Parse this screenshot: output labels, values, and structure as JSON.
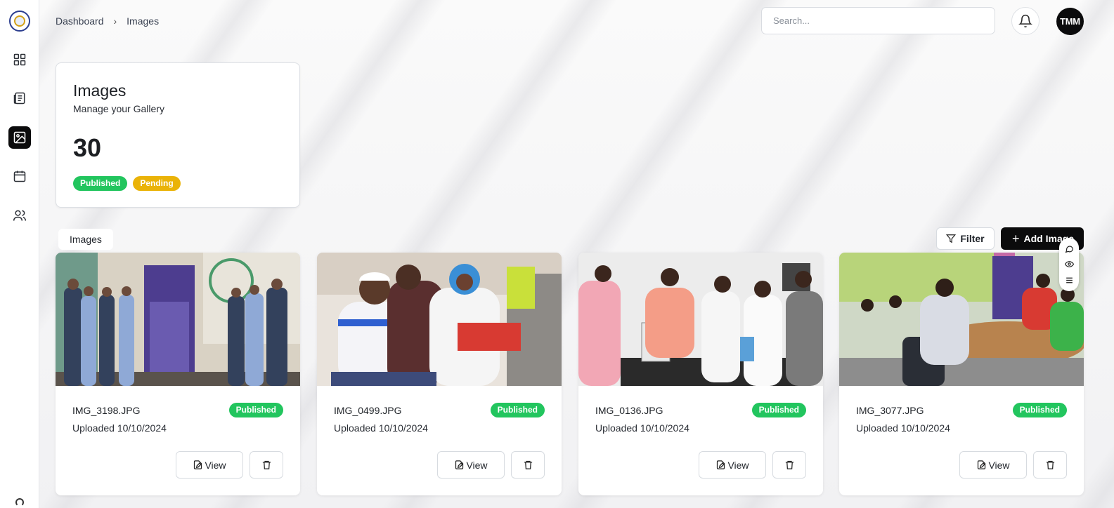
{
  "breadcrumb": {
    "items": [
      "Dashboard",
      "Images"
    ]
  },
  "search": {
    "placeholder": "Search...",
    "value": ""
  },
  "user": {
    "initials": "TMM"
  },
  "sidebar": {
    "items": [
      {
        "icon": "grid-icon",
        "label": "Dashboard"
      },
      {
        "icon": "newspaper-icon",
        "label": "News"
      },
      {
        "icon": "image-icon",
        "label": "Images",
        "active": true
      },
      {
        "icon": "calendar-icon",
        "label": "Events"
      },
      {
        "icon": "users-icon",
        "label": "Users"
      }
    ]
  },
  "summary": {
    "title": "Images",
    "subtitle": "Manage your Gallery",
    "count": "30",
    "badges": {
      "published": "Published",
      "pending": "Pending"
    }
  },
  "toolbar": {
    "tab_label": "Images",
    "filter_label": "Filter",
    "add_label": "Add Image"
  },
  "colors": {
    "published": "#22c55e",
    "pending": "#eab308",
    "primary": "#0b0b0c"
  },
  "cards": [
    {
      "filename": "IMG_3198.JPG",
      "uploaded": "Uploaded 10/10/2024",
      "status": "Published",
      "view_label": "View"
    },
    {
      "filename": "IMG_0499.JPG",
      "uploaded": "Uploaded 10/10/2024",
      "status": "Published",
      "view_label": "View"
    },
    {
      "filename": "IMG_0136.JPG",
      "uploaded": "Uploaded 10/10/2024",
      "status": "Published",
      "view_label": "View"
    },
    {
      "filename": "IMG_3077.JPG",
      "uploaded": "Uploaded 10/10/2024",
      "status": "Published",
      "view_label": "View"
    }
  ]
}
